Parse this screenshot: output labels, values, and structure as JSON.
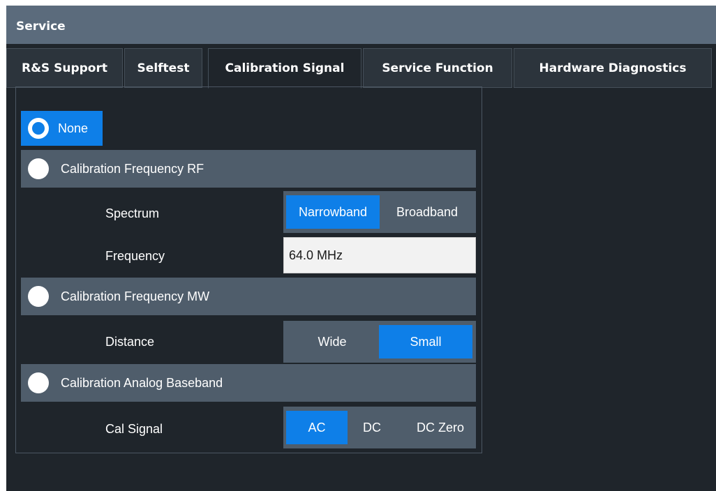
{
  "window": {
    "title": "Service"
  },
  "tabs": [
    {
      "label": "R&S Support"
    },
    {
      "label": "Selftest"
    },
    {
      "label": "Calibration Signal",
      "active": true
    },
    {
      "label": "Service Function"
    },
    {
      "label": "Hardware Diagnostics"
    }
  ],
  "calibration": {
    "none_label": "None",
    "rf": {
      "label": "Calibration Frequency RF",
      "spectrum_label": "Spectrum",
      "spectrum_options": [
        "Narrowband",
        "Broadband"
      ],
      "spectrum_selected": "Narrowband",
      "frequency_label": "Frequency",
      "frequency_value": "64.0 MHz"
    },
    "mw": {
      "label": "Calibration Frequency MW",
      "distance_label": "Distance",
      "distance_options": [
        "Wide",
        "Small"
      ],
      "distance_selected": "Small"
    },
    "abb": {
      "label": "Calibration Analog Baseband",
      "cal_signal_label": "Cal Signal",
      "cal_signal_options": [
        "AC",
        "DC",
        "DC Zero"
      ],
      "cal_signal_selected": "AC"
    },
    "selected": "None"
  },
  "colors": {
    "accent": "#0e7fe8",
    "titlebar": "#5b6b7c",
    "background": "#1f252b",
    "row": "#4f5d6b"
  }
}
